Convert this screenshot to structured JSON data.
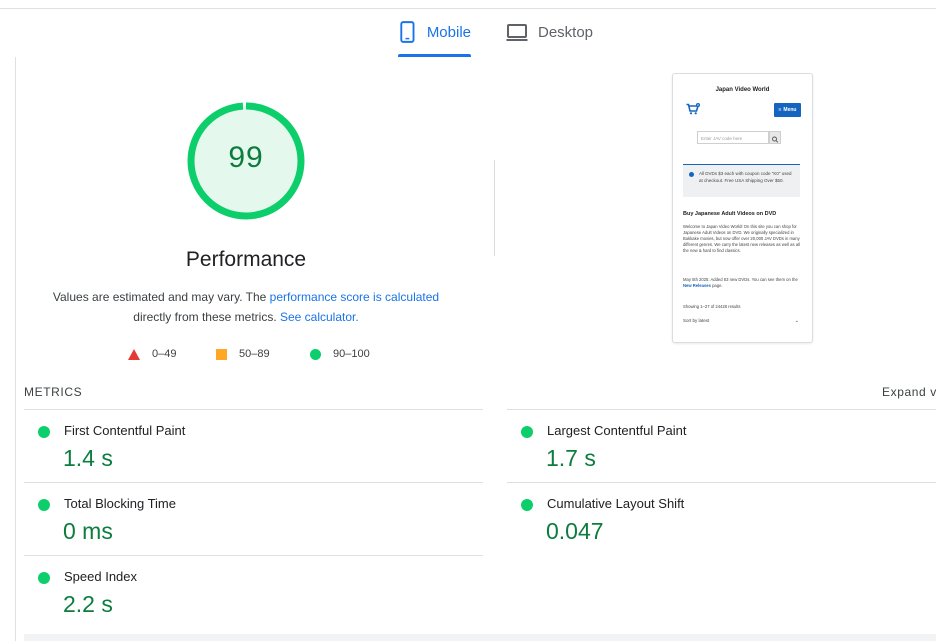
{
  "tabs": [
    {
      "label": "Mobile",
      "icon": "smartphone-icon",
      "active": true
    },
    {
      "label": "Desktop",
      "icon": "monitor-icon",
      "active": false
    }
  ],
  "gauge": {
    "score": "99",
    "title": "Performance",
    "color": "#0cce6b"
  },
  "description": {
    "prefix": "Values are estimated and may vary. The ",
    "link_score": "performance score is calculated",
    "middle": " directly from these metrics. ",
    "link_calc": "See calculator."
  },
  "legend": [
    {
      "range": "0–49",
      "color": "#e53935",
      "shape": "triangle"
    },
    {
      "range": "50–89",
      "color": "#ffa726",
      "shape": "square"
    },
    {
      "range": "90–100",
      "color": "#0cce6b",
      "shape": "circle"
    }
  ],
  "screenshot": {
    "title": "Japan Video World",
    "cart_badge": "0",
    "menu_label": "Menu",
    "search_placeholder": "Enter JAV code here",
    "notice": "All DVDs $3 each with coupon code \"K0\" used at checkout. Free USA Shipping Over $50.",
    "heading": "Buy Japanese Adult Videos on DVD",
    "paragraph": "Welcome to Japan Video World! On this site you can shop for Japanese Adult Videos on DVD. We originally specialized in Bukkake movies, but now offer over 20,000 JAV DVDs in many different genres. We carry the latest new releases as well as all the new & hard to find classics.",
    "news_prefix": "May 5th 2025: Added 63 new DVDs. You can see them on the ",
    "news_link": "New Releases",
    "news_suffix": " page.",
    "results": "Showing 1–27 of 24428 results",
    "sort": "Sort by latest"
  },
  "metrics": {
    "title": "METRICS",
    "expand": "Expand view",
    "items": [
      {
        "label": "First Contentful Paint",
        "value": "1.4 s"
      },
      {
        "label": "Largest Contentful Paint",
        "value": "1.7 s"
      },
      {
        "label": "Total Blocking Time",
        "value": "0 ms"
      },
      {
        "label": "Cumulative Layout Shift",
        "value": "0.047"
      },
      {
        "label": "Speed Index",
        "value": "2.2 s"
      }
    ]
  },
  "colors": {
    "accent": "#1a73e8",
    "pass": "#0cce6b",
    "pass_text": "#0c7c3f"
  }
}
